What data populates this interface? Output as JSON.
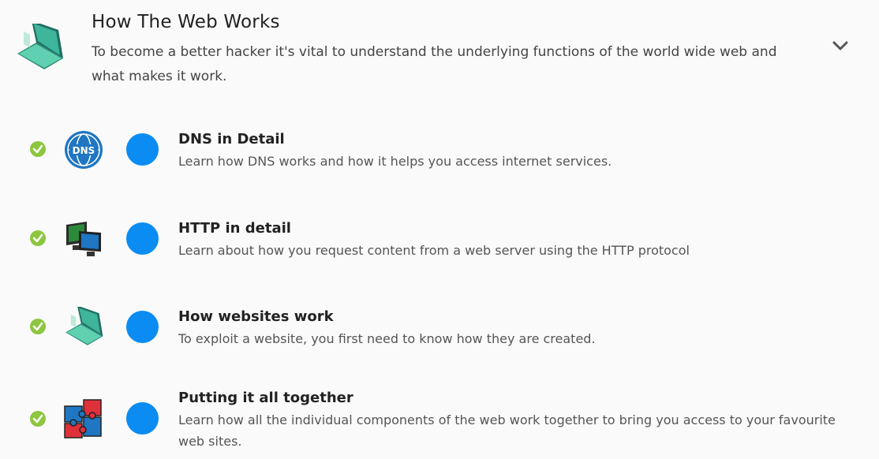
{
  "module": {
    "title": "How The Web Works",
    "description": "To become a better hacker it's vital to understand the underlying functions of the world wide web and what makes it work.",
    "icon": "laptop-icon",
    "toggle_icon": "chevron-down-icon"
  },
  "rooms": [
    {
      "title": "DNS in Detail",
      "description": "Learn how DNS works and how it helps you access internet services.",
      "icon": "dns-globe-icon",
      "completed": true
    },
    {
      "title": "HTTP in detail",
      "description": "Learn about how you request content from a web server using the HTTP protocol",
      "icon": "computer-monitors-icon",
      "completed": true
    },
    {
      "title": "How websites work",
      "description": "To exploit a website, you first need to know how they are created.",
      "icon": "laptop-icon",
      "completed": true
    },
    {
      "title": "Putting it all together",
      "description": "Learn how all the individual components of the web work together to bring you access to your favourite web sites.",
      "icon": "puzzle-pieces-icon",
      "completed": true
    }
  ],
  "colors": {
    "accent_dot": "#0a8cf2",
    "check_green": "#8dc63f"
  }
}
